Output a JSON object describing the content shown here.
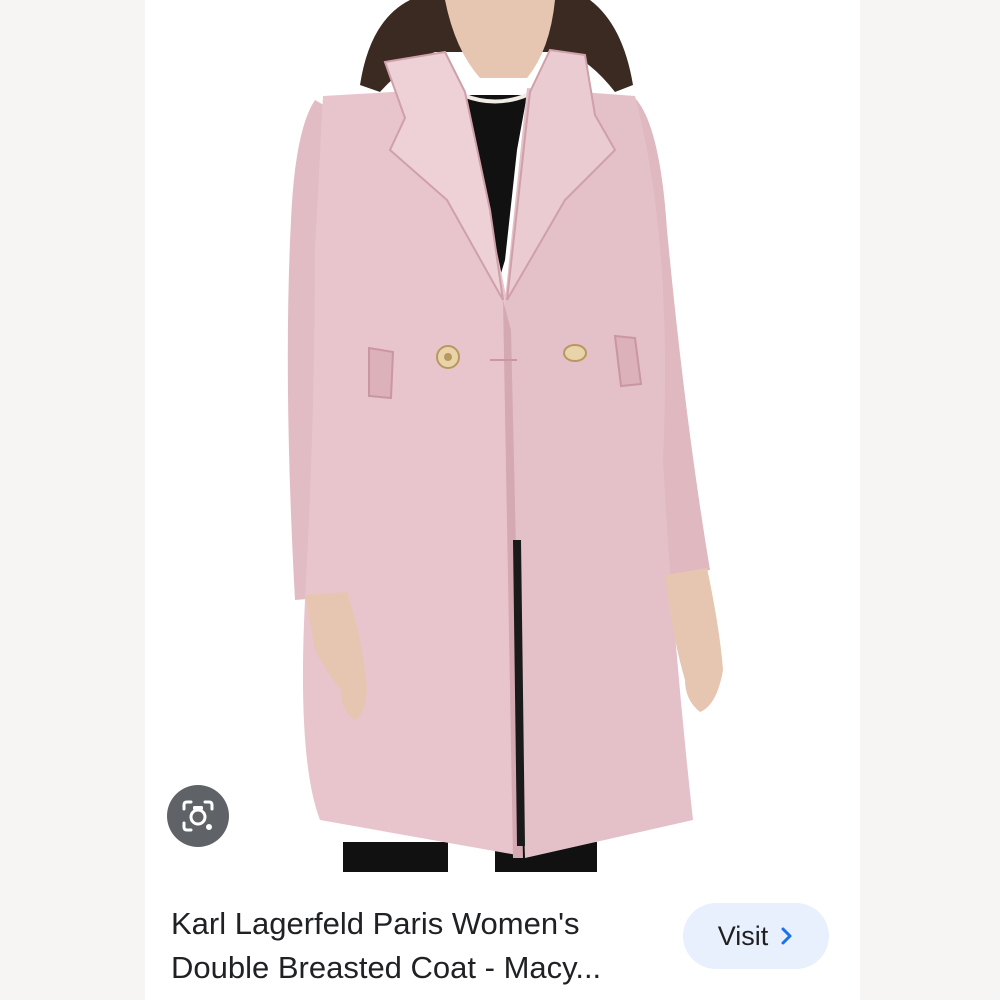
{
  "result": {
    "title_line1": "Karl Lagerfeld Paris Women's",
    "title_line2": "Double Breasted Coat - Macy...",
    "visit_label": "Visit"
  },
  "icons": {
    "lens": "google-lens-camera-icon",
    "visit_chevron": "chevron-right-icon"
  },
  "colors": {
    "coat": "#e8c5cc",
    "visit_button_bg": "#e8f0fe",
    "visit_chevron": "#1a73e8",
    "lens_button_bg": "#5f6368"
  }
}
